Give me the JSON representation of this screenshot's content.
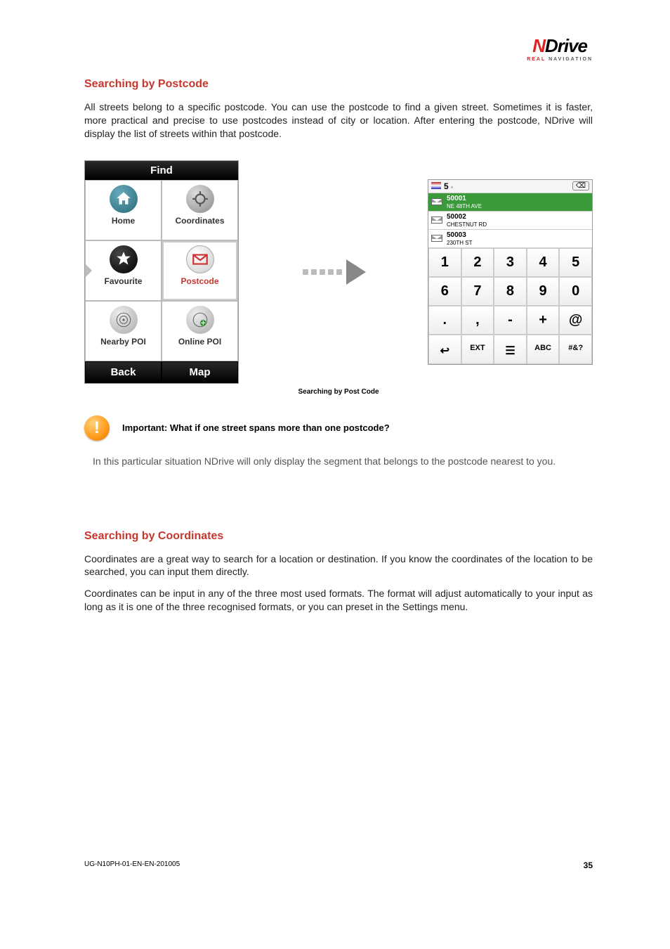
{
  "logo": {
    "brand_n": "N",
    "brand_rest": "Drive",
    "tag_real": "REAL",
    "tag_nav": "NAVIGATION"
  },
  "section1": {
    "title": "Searching by Postcode",
    "para": "All streets belong to a specific postcode. You can use the postcode to find a given street. Sometimes it is faster, more practical and precise to use postcodes instead of city or location. After entering the postcode, NDrive will display the list of streets within that postcode."
  },
  "find": {
    "title": "Find",
    "home": "Home",
    "coordinates": "Coordinates",
    "favourite": "Favourite",
    "postcode": "Postcode",
    "nearby": "Nearby POI",
    "online": "Online POI",
    "back": "Back",
    "map": "Map"
  },
  "kb": {
    "input": "5",
    "rows": [
      {
        "code": "50001",
        "street": "NE 48TH AVE"
      },
      {
        "code": "50002",
        "street": "CHESTNUT RD"
      },
      {
        "code": "50003",
        "street": "230TH ST"
      }
    ],
    "keys": [
      "1",
      "2",
      "3",
      "4",
      "5",
      "6",
      "7",
      "8",
      "9",
      "0",
      ".",
      ",",
      "-",
      "+",
      "@"
    ],
    "fn": {
      "ext": "EXT",
      "abc": "ABC",
      "sym": "#&?"
    }
  },
  "figcaption": "Searching by Post Code",
  "important": {
    "label": "Important: What if one street spans more than one postcode?",
    "para": "In this particular situation NDrive will only display the segment that belongs to the postcode nearest to you."
  },
  "section2": {
    "title": "Searching by Coordinates",
    "p1": "Coordinates are a great way to search for a location or destination. If you know the coordinates of the location to be searched, you can input them directly.",
    "p2": "Coordinates can be input in any of the three most used formats. The format will adjust automatically to your input as long as it is one of the three recognised formats, or you can preset in the Settings menu."
  },
  "footer": {
    "doc": "UG-N10PH-01-EN-EN-201005",
    "page": "35"
  }
}
